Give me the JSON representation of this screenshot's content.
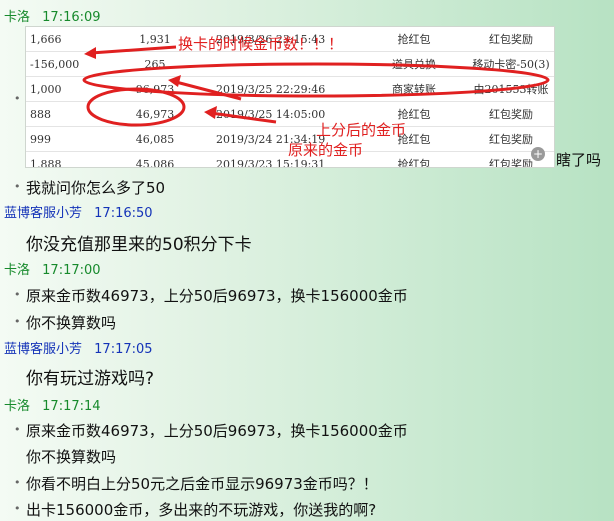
{
  "messages": [
    {
      "sender": "卡洛",
      "time": "17:16:09",
      "type": "customer"
    },
    {
      "sender": "蓝博客服小芳",
      "time": "17:16:50",
      "type": "service"
    },
    {
      "sender": "卡洛",
      "time": "17:17:00",
      "type": "customer"
    },
    {
      "sender": "蓝博客服小芳",
      "time": "17:17:05",
      "type": "service"
    },
    {
      "sender": "卡洛",
      "time": "17:17:14",
      "type": "customer"
    }
  ],
  "screenshot": {
    "rows": [
      [
        "1,666",
        "1,931",
        "2019/3/26 23:15:43",
        "抢红包",
        "红包奖励"
      ],
      [
        "-156,000",
        "265",
        "",
        "道具兑换",
        "移动卡密-50(3)"
      ],
      [
        "1,000",
        "96,973",
        "2019/3/25 22:29:46",
        "商家转账",
        "由201553转账"
      ],
      [
        "888",
        "46,973",
        "2019/3/25 14:05:00",
        "抢红包",
        "红包奖励"
      ],
      [
        "999",
        "46,085",
        "2019/3/24 21:34:19",
        "抢红包",
        "红包奖励"
      ],
      [
        "1,888",
        "45,086",
        "2019/3/23 15:19:31",
        "抢红包",
        "红包奖励"
      ]
    ],
    "annotation_top": "换卡的时候金币数！！！",
    "annotation_mid_1": "上分后的金币",
    "annotation_mid_2": "原来的金币",
    "annotation_color": "#e02020",
    "zoom_icon": "zoom-in-icon"
  },
  "texts": {
    "after_image": "瞎了吗",
    "m1": "我就问你怎么多了50",
    "m2": "你没充值那里来的50积分下卡",
    "m3a": "原来金币数46973，上分50后96973，换卡156000金币",
    "m3b": "你不换算数吗",
    "m4": "你有玩过游戏吗?",
    "m5a": "原来金币数46973，上分50后96973，换卡156000金币",
    "m5b": "你不换算数吗",
    "m5c": "你看不明白上分50元之后金币显示96973金币吗？！",
    "m5d": "出卡156000金币，多出来的不玩游戏，你送我的啊?"
  }
}
